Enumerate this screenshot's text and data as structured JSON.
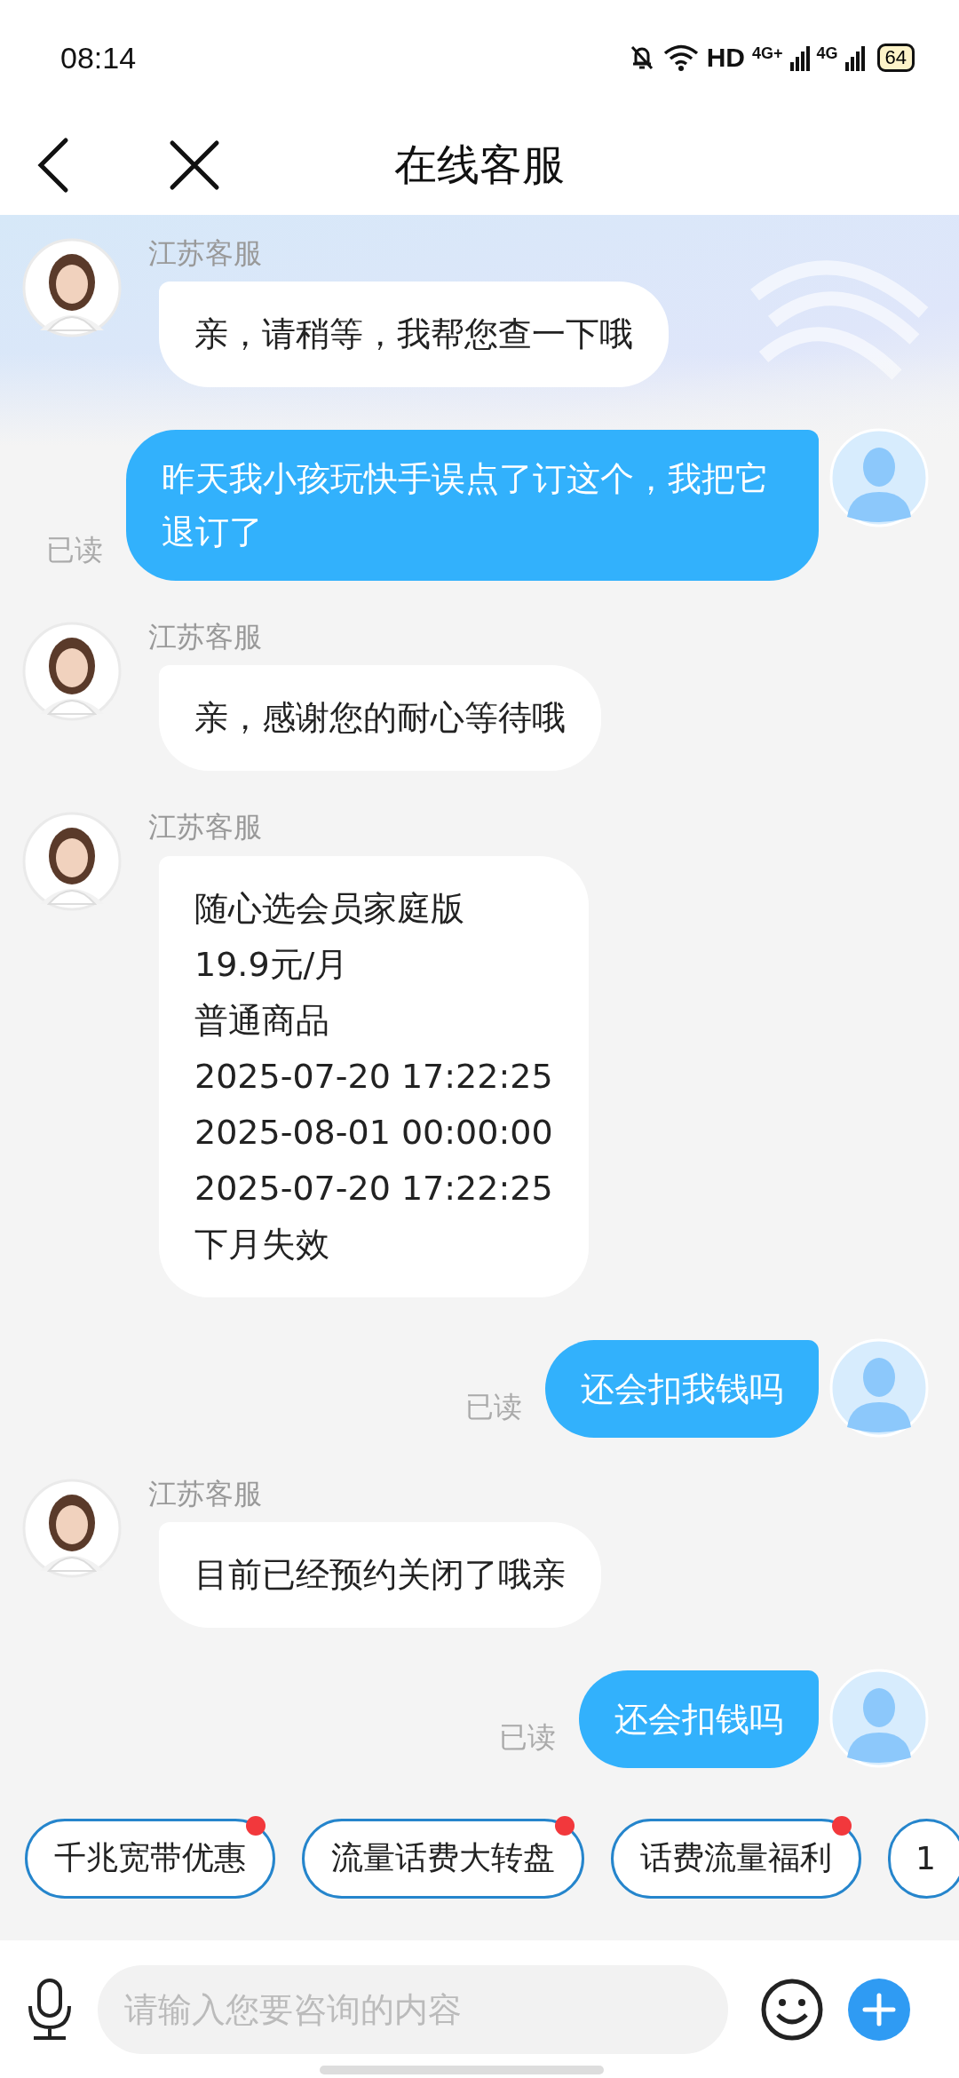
{
  "status_bar": {
    "time": "08:14",
    "hd": "HD",
    "sim1": "4G+",
    "sim2": "4G",
    "battery": "64"
  },
  "header": {
    "title": "在线客服"
  },
  "messages": [
    {
      "kind": "agent",
      "name": "江苏客服",
      "lines": [
        "亲，请稍等，我帮您查一下哦"
      ]
    },
    {
      "kind": "user",
      "text": "昨天我小孩玩快手误点了订这个，我把它退订了",
      "status": "已读"
    },
    {
      "kind": "agent",
      "name": "江苏客服",
      "lines": [
        "亲，感谢您的耐心等待哦"
      ]
    },
    {
      "kind": "agent",
      "name": "江苏客服",
      "lines": [
        "随心选会员家庭版",
        "19.9元/月",
        "普通商品",
        "2025-07-20 17:22:25",
        "2025-08-01 00:00:00",
        "2025-07-20 17:22:25",
        "下月失效"
      ]
    },
    {
      "kind": "user",
      "text": "还会扣我钱吗",
      "status": "已读"
    },
    {
      "kind": "agent",
      "name": "江苏客服",
      "lines": [
        "目前已经预约关闭了哦亲"
      ]
    },
    {
      "kind": "user",
      "text": "还会扣钱吗",
      "status": "已读"
    }
  ],
  "quick_replies": [
    {
      "label": "千兆宽带优惠",
      "badge": true
    },
    {
      "label": "流量话费大转盘",
      "badge": true
    },
    {
      "label": "话费流量福利",
      "badge": true
    },
    {
      "label": "1",
      "badge": false
    }
  ],
  "input": {
    "placeholder": "请输入您要咨询的内容"
  }
}
